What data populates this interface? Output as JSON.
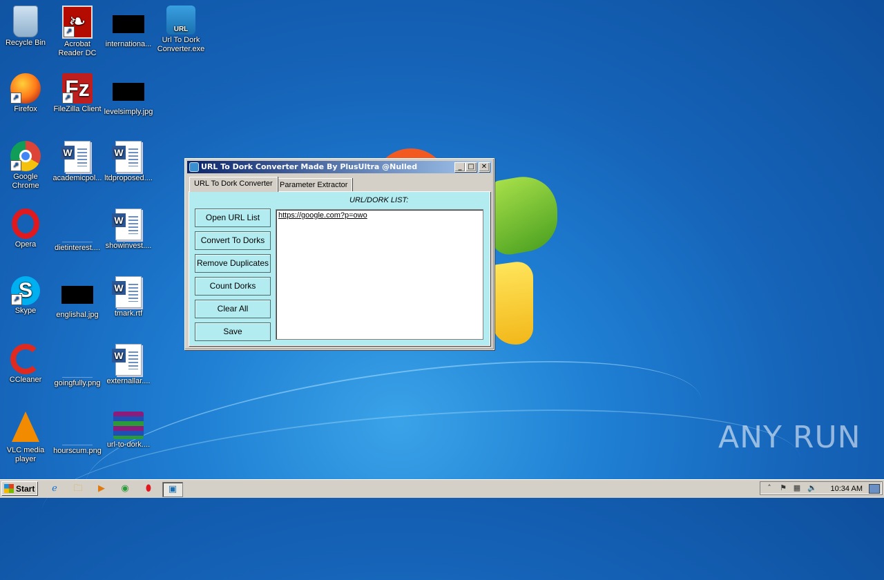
{
  "desktop": {
    "icons": [
      {
        "label": "Recycle Bin",
        "icon": "recycle-bin-icon"
      },
      {
        "label": "Acrobat Reader DC",
        "icon": "acrobat-icon"
      },
      {
        "label": "internationa...",
        "icon": "image-file-icon"
      },
      {
        "label": "Url To Dork Converter.exe",
        "icon": "url-app-icon"
      },
      {
        "label": "Firefox",
        "icon": "firefox-icon"
      },
      {
        "label": "FileZilla Client",
        "icon": "filezilla-icon"
      },
      {
        "label": "levelsimply.jpg",
        "icon": "image-file-icon"
      },
      {
        "label": "Google Chrome",
        "icon": "chrome-icon"
      },
      {
        "label": "academicpol...",
        "icon": "word-doc-icon"
      },
      {
        "label": "ltdproposed....",
        "icon": "word-doc-icon"
      },
      {
        "label": "Opera",
        "icon": "opera-icon"
      },
      {
        "label": "dietinterest....",
        "icon": "blank-file-icon"
      },
      {
        "label": "showinvest....",
        "icon": "word-doc-icon"
      },
      {
        "label": "Skype",
        "icon": "skype-icon"
      },
      {
        "label": "englishal.jpg",
        "icon": "image-file-icon"
      },
      {
        "label": "tmark.rtf",
        "icon": "word-doc-icon"
      },
      {
        "label": "CCleaner",
        "icon": "ccleaner-icon"
      },
      {
        "label": "goingfully.png",
        "icon": "blank-file-icon"
      },
      {
        "label": "externallar....",
        "icon": "word-doc-icon"
      },
      {
        "label": "VLC media player",
        "icon": "vlc-icon"
      },
      {
        "label": "hourscum.png",
        "icon": "blank-file-icon"
      },
      {
        "label": "url-to-dork....",
        "icon": "winrar-icon"
      }
    ]
  },
  "window": {
    "title": "URL To Dork Converter Made By PlusUltra @Nulled",
    "tabs": [
      {
        "label": "URL To Dork Converter",
        "active": true
      },
      {
        "label": "Parameter Extractor",
        "active": false
      }
    ],
    "list_label": "URL/DORK LIST:",
    "buttons": [
      {
        "label": "Open URL List"
      },
      {
        "label": "Convert To Dorks"
      },
      {
        "label": "Remove Duplicates"
      },
      {
        "label": "Count Dorks"
      },
      {
        "label": "Clear All"
      },
      {
        "label": "Save"
      }
    ],
    "textarea_value": "https://google.com?p=owo",
    "panel_color": "#b3ecf0",
    "titlebar_color": "#0a246a"
  },
  "taskbar": {
    "start_label": "Start",
    "apps": [
      "internet-explorer-icon",
      "explorer-icon",
      "media-player-icon",
      "chrome-icon",
      "opera-icon",
      "url-app-icon"
    ],
    "clock": "10:34 AM"
  },
  "watermark": "ANY RUN"
}
